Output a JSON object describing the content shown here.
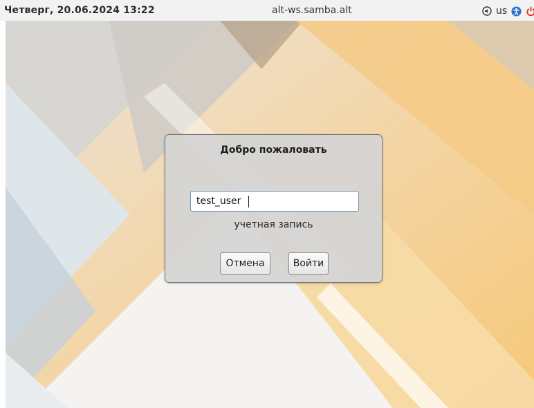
{
  "topbar": {
    "datetime": "Четверг, 20.06.2024 13:22",
    "hostname": "alt-ws.samba.alt",
    "keyboard_layout": "us",
    "icons": [
      "sound-icon",
      "accessibility-icon",
      "power-icon"
    ]
  },
  "login_dialog": {
    "title": "Добро пожаловать",
    "username_value": "test_user",
    "field_label": "учетная запись",
    "cancel_label": "Отмена",
    "login_label": "Войти"
  },
  "colors": {
    "topbar_bg": "#f2f2f2",
    "dialog_bg": "#d4d4d4",
    "input_border": "#6c8fb3",
    "wallpaper_warm": "#f6c77f",
    "wallpaper_cool": "#c9d6de"
  }
}
